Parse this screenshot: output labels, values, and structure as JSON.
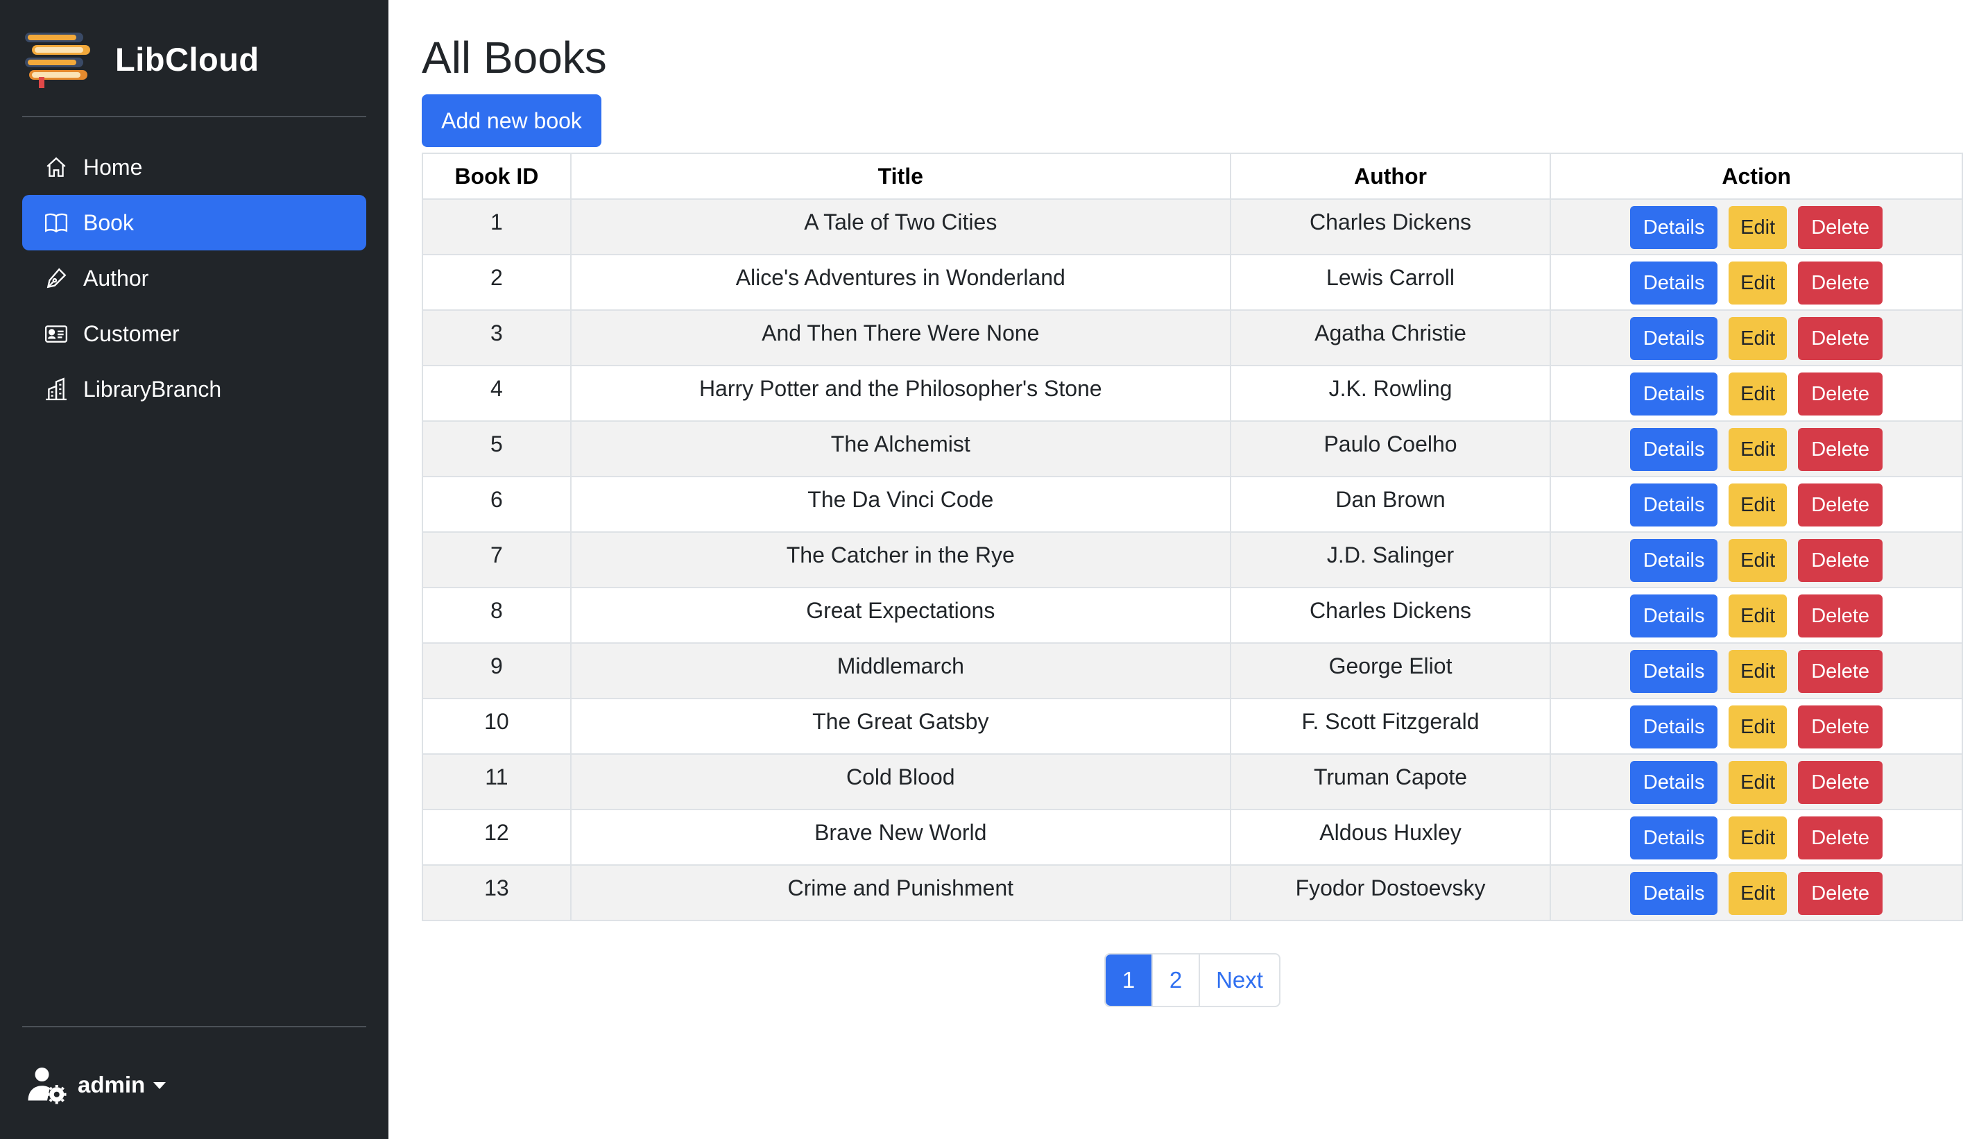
{
  "app": {
    "brand": "LibCloud"
  },
  "sidebar": {
    "items": [
      {
        "label": "Home",
        "icon": "house-icon",
        "active": false
      },
      {
        "label": "Book",
        "icon": "book-icon",
        "active": true
      },
      {
        "label": "Author",
        "icon": "pen-icon",
        "active": false
      },
      {
        "label": "Customer",
        "icon": "person-card-icon",
        "active": false
      },
      {
        "label": "LibraryBranch",
        "icon": "building-icon",
        "active": false
      }
    ],
    "user": {
      "name": "admin",
      "icon": "user-gear-icon"
    }
  },
  "main": {
    "title": "All Books",
    "add_button": "Add new book",
    "table": {
      "headers": [
        "Book ID",
        "Title",
        "Author",
        "Action"
      ],
      "actions": {
        "details": "Details",
        "edit": "Edit",
        "delete": "Delete"
      },
      "rows": [
        {
          "id": "1",
          "title": "A Tale of Two Cities",
          "author": "Charles Dickens"
        },
        {
          "id": "2",
          "title": "Alice's Adventures in Wonderland",
          "author": "Lewis Carroll"
        },
        {
          "id": "3",
          "title": "And Then There Were None",
          "author": "Agatha Christie"
        },
        {
          "id": "4",
          "title": "Harry Potter and the Philosopher's Stone",
          "author": "J.K. Rowling"
        },
        {
          "id": "5",
          "title": "The Alchemist",
          "author": "Paulo Coelho"
        },
        {
          "id": "6",
          "title": "The Da Vinci Code",
          "author": "Dan Brown"
        },
        {
          "id": "7",
          "title": "The Catcher in the Rye",
          "author": "J.D. Salinger"
        },
        {
          "id": "8",
          "title": "Great Expectations",
          "author": "Charles Dickens"
        },
        {
          "id": "9",
          "title": "Middlemarch",
          "author": "George Eliot"
        },
        {
          "id": "10",
          "title": "The Great Gatsby",
          "author": "F. Scott Fitzgerald"
        },
        {
          "id": "11",
          "title": "Cold Blood",
          "author": "Truman Capote"
        },
        {
          "id": "12",
          "title": "Brave New World",
          "author": "Aldous Huxley"
        },
        {
          "id": "13",
          "title": "Crime and Punishment",
          "author": "Fyodor Dostoevsky"
        }
      ]
    },
    "pagination": {
      "pages": [
        "1",
        "2"
      ],
      "current": "1",
      "next": "Next"
    }
  },
  "colors": {
    "sidebar_bg": "#212529",
    "primary": "#2f6ff0",
    "warning": "#f5c542",
    "danger": "#d53b48"
  }
}
